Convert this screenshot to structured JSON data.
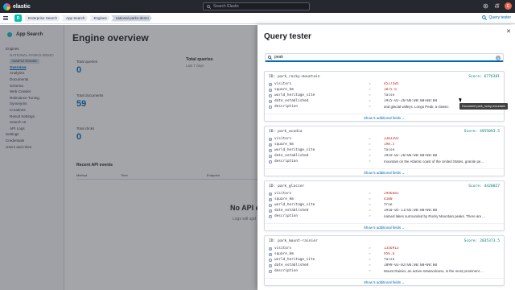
{
  "header": {
    "logo_text": "elastic",
    "search_placeholder": "Search Elastic",
    "avatar_initial": "E"
  },
  "breadcrumbs": [
    "Enterprise Search",
    "App Search",
    "Engines",
    "national-parks-demo"
  ],
  "app_badge": "D",
  "query_tester_link": "Query tester",
  "sidebar": {
    "title": "App Search",
    "items": [
      {
        "label": "Engines",
        "type": "top"
      },
      {
        "label": "NATIONAL-PARKS-DEMO",
        "type": "muted"
      },
      {
        "label": "SAMPLE ENGINE",
        "type": "badge"
      },
      {
        "label": "Overview",
        "type": "active"
      },
      {
        "label": "Analytics",
        "type": "sub"
      },
      {
        "label": "Documents",
        "type": "sub"
      },
      {
        "label": "Schema",
        "type": "sub"
      },
      {
        "label": "Web Crawler",
        "type": "sub"
      },
      {
        "label": "Relevance Tuning",
        "type": "sub"
      },
      {
        "label": "Synonyms",
        "type": "sub"
      },
      {
        "label": "Curations",
        "type": "sub"
      },
      {
        "label": "Result Settings",
        "type": "sub"
      },
      {
        "label": "Search UI",
        "type": "sub"
      },
      {
        "label": "API Logs",
        "type": "sub"
      },
      {
        "label": "Settings",
        "type": "top"
      },
      {
        "label": "Credentials",
        "type": "top"
      },
      {
        "label": "Users and roles",
        "type": "top"
      }
    ]
  },
  "overview": {
    "title": "Engine overview",
    "stats": [
      {
        "label": "Total queries",
        "value": "0"
      },
      {
        "label": "Total documents",
        "value": "59"
      },
      {
        "label": "Total clicks",
        "value": "0"
      }
    ],
    "chart_title": "Total queries",
    "chart_subtitle": "Last 7 days",
    "recent_title": "Recent API events",
    "recent_cols": [
      "Method",
      "Time",
      "Endpoint"
    ],
    "empty_title": "No API e",
    "empty_sub": "Logs will upd"
  },
  "flyout": {
    "title": "Query tester",
    "search_value": "peak",
    "show_more": "Show 5 additional fields",
    "tooltip": "Document park_rocky-mountain",
    "results": [
      {
        "id": "ID: park_rocky-mountain",
        "score": "Score: 6776381",
        "fields": [
          {
            "icon": "#",
            "name": "visitors",
            "value": "4517585",
            "kind": "num"
          },
          {
            "icon": "#",
            "name": "square_km",
            "value": "1075.6",
            "kind": "num"
          },
          {
            "icon": "t",
            "name": "world_heritage_site",
            "value": "false",
            "kind": "plain"
          },
          {
            "icon": "d",
            "name": "date_established",
            "value": "1915-01-26T06:00:00+00:00",
            "kind": "plain"
          },
          {
            "icon": "t",
            "name": "description",
            "value": "and glacial valleys. Longs Peak, a classic",
            "kind": "txt"
          }
        ]
      },
      {
        "id": "ID: park_acadia",
        "score": "Score: 4955093.5",
        "fields": [
          {
            "icon": "#",
            "name": "visitors",
            "value": "3303393",
            "kind": "num"
          },
          {
            "icon": "#",
            "name": "square_km",
            "value": "198.5",
            "kind": "num"
          },
          {
            "icon": "t",
            "name": "world_heritage_site",
            "value": "false",
            "kind": "plain"
          },
          {
            "icon": "d",
            "name": "date_established",
            "value": "1919-02-26T06:00:00+00:00",
            "kind": "plain"
          },
          {
            "icon": "t",
            "name": "description",
            "value": "mountain on the Atlantic coast of the United States, granite pe...",
            "kind": "txt"
          }
        ]
      },
      {
        "id": "ID: park_glacier",
        "score": "Score: 4420027",
        "fields": [
          {
            "icon": "#",
            "name": "visitors",
            "value": "2946681",
            "kind": "num"
          },
          {
            "icon": "#",
            "name": "square_km",
            "value": "4100",
            "kind": "num"
          },
          {
            "icon": "t",
            "name": "world_heritage_site",
            "value": "true",
            "kind": "plain"
          },
          {
            "icon": "d",
            "name": "date_established",
            "value": "1910-05-11T05:00:00+00:00",
            "kind": "plain"
          },
          {
            "icon": "t",
            "name": "description",
            "value": "named lakes surrounded by Rocky Mountain peaks. There are ...",
            "kind": "txt"
          }
        ]
      },
      {
        "id": "ID: park_mount-rainier",
        "score": "Score: 2035373.5",
        "fields": [
          {
            "icon": "#",
            "name": "visitors",
            "value": "1356913",
            "kind": "num"
          },
          {
            "icon": "#",
            "name": "square_km",
            "value": "956.6",
            "kind": "num"
          },
          {
            "icon": "t",
            "name": "world_heritage_site",
            "value": "false",
            "kind": "plain"
          },
          {
            "icon": "d",
            "name": "date_established",
            "value": "1899-03-02T06:00:00+00:00",
            "kind": "plain"
          },
          {
            "icon": "t",
            "name": "description",
            "value": "Mount Rainier, an active stratovolcano, is the most prominent ...",
            "kind": "txt"
          }
        ]
      }
    ]
  }
}
